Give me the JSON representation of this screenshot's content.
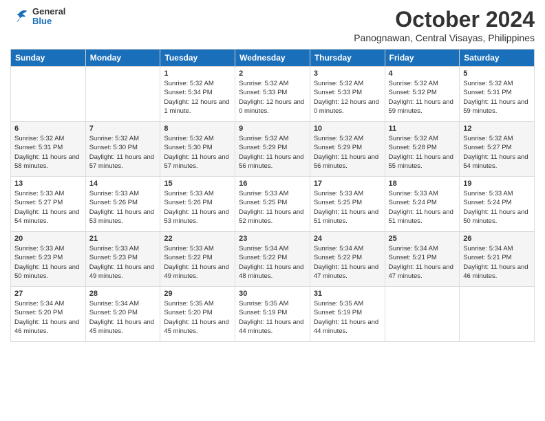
{
  "header": {
    "logo_general": "General",
    "logo_blue": "Blue",
    "month": "October 2024",
    "location": "Panognawan, Central Visayas, Philippines"
  },
  "days_of_week": [
    "Sunday",
    "Monday",
    "Tuesday",
    "Wednesday",
    "Thursday",
    "Friday",
    "Saturday"
  ],
  "weeks": [
    [
      {
        "day": "",
        "detail": ""
      },
      {
        "day": "",
        "detail": ""
      },
      {
        "day": "1",
        "detail": "Sunrise: 5:32 AM\nSunset: 5:34 PM\nDaylight: 12 hours\nand 1 minute."
      },
      {
        "day": "2",
        "detail": "Sunrise: 5:32 AM\nSunset: 5:33 PM\nDaylight: 12 hours\nand 0 minutes."
      },
      {
        "day": "3",
        "detail": "Sunrise: 5:32 AM\nSunset: 5:33 PM\nDaylight: 12 hours\nand 0 minutes."
      },
      {
        "day": "4",
        "detail": "Sunrise: 5:32 AM\nSunset: 5:32 PM\nDaylight: 11 hours\nand 59 minutes."
      },
      {
        "day": "5",
        "detail": "Sunrise: 5:32 AM\nSunset: 5:31 PM\nDaylight: 11 hours\nand 59 minutes."
      }
    ],
    [
      {
        "day": "6",
        "detail": "Sunrise: 5:32 AM\nSunset: 5:31 PM\nDaylight: 11 hours\nand 58 minutes."
      },
      {
        "day": "7",
        "detail": "Sunrise: 5:32 AM\nSunset: 5:30 PM\nDaylight: 11 hours\nand 57 minutes."
      },
      {
        "day": "8",
        "detail": "Sunrise: 5:32 AM\nSunset: 5:30 PM\nDaylight: 11 hours\nand 57 minutes."
      },
      {
        "day": "9",
        "detail": "Sunrise: 5:32 AM\nSunset: 5:29 PM\nDaylight: 11 hours\nand 56 minutes."
      },
      {
        "day": "10",
        "detail": "Sunrise: 5:32 AM\nSunset: 5:29 PM\nDaylight: 11 hours\nand 56 minutes."
      },
      {
        "day": "11",
        "detail": "Sunrise: 5:32 AM\nSunset: 5:28 PM\nDaylight: 11 hours\nand 55 minutes."
      },
      {
        "day": "12",
        "detail": "Sunrise: 5:32 AM\nSunset: 5:27 PM\nDaylight: 11 hours\nand 54 minutes."
      }
    ],
    [
      {
        "day": "13",
        "detail": "Sunrise: 5:33 AM\nSunset: 5:27 PM\nDaylight: 11 hours\nand 54 minutes."
      },
      {
        "day": "14",
        "detail": "Sunrise: 5:33 AM\nSunset: 5:26 PM\nDaylight: 11 hours\nand 53 minutes."
      },
      {
        "day": "15",
        "detail": "Sunrise: 5:33 AM\nSunset: 5:26 PM\nDaylight: 11 hours\nand 53 minutes."
      },
      {
        "day": "16",
        "detail": "Sunrise: 5:33 AM\nSunset: 5:25 PM\nDaylight: 11 hours\nand 52 minutes."
      },
      {
        "day": "17",
        "detail": "Sunrise: 5:33 AM\nSunset: 5:25 PM\nDaylight: 11 hours\nand 51 minutes."
      },
      {
        "day": "18",
        "detail": "Sunrise: 5:33 AM\nSunset: 5:24 PM\nDaylight: 11 hours\nand 51 minutes."
      },
      {
        "day": "19",
        "detail": "Sunrise: 5:33 AM\nSunset: 5:24 PM\nDaylight: 11 hours\nand 50 minutes."
      }
    ],
    [
      {
        "day": "20",
        "detail": "Sunrise: 5:33 AM\nSunset: 5:23 PM\nDaylight: 11 hours\nand 50 minutes."
      },
      {
        "day": "21",
        "detail": "Sunrise: 5:33 AM\nSunset: 5:23 PM\nDaylight: 11 hours\nand 49 minutes."
      },
      {
        "day": "22",
        "detail": "Sunrise: 5:33 AM\nSunset: 5:22 PM\nDaylight: 11 hours\nand 49 minutes."
      },
      {
        "day": "23",
        "detail": "Sunrise: 5:34 AM\nSunset: 5:22 PM\nDaylight: 11 hours\nand 48 minutes."
      },
      {
        "day": "24",
        "detail": "Sunrise: 5:34 AM\nSunset: 5:22 PM\nDaylight: 11 hours\nand 47 minutes."
      },
      {
        "day": "25",
        "detail": "Sunrise: 5:34 AM\nSunset: 5:21 PM\nDaylight: 11 hours\nand 47 minutes."
      },
      {
        "day": "26",
        "detail": "Sunrise: 5:34 AM\nSunset: 5:21 PM\nDaylight: 11 hours\nand 46 minutes."
      }
    ],
    [
      {
        "day": "27",
        "detail": "Sunrise: 5:34 AM\nSunset: 5:20 PM\nDaylight: 11 hours\nand 46 minutes."
      },
      {
        "day": "28",
        "detail": "Sunrise: 5:34 AM\nSunset: 5:20 PM\nDaylight: 11 hours\nand 45 minutes."
      },
      {
        "day": "29",
        "detail": "Sunrise: 5:35 AM\nSunset: 5:20 PM\nDaylight: 11 hours\nand 45 minutes."
      },
      {
        "day": "30",
        "detail": "Sunrise: 5:35 AM\nSunset: 5:19 PM\nDaylight: 11 hours\nand 44 minutes."
      },
      {
        "day": "31",
        "detail": "Sunrise: 5:35 AM\nSunset: 5:19 PM\nDaylight: 11 hours\nand 44 minutes."
      },
      {
        "day": "",
        "detail": ""
      },
      {
        "day": "",
        "detail": ""
      }
    ]
  ]
}
